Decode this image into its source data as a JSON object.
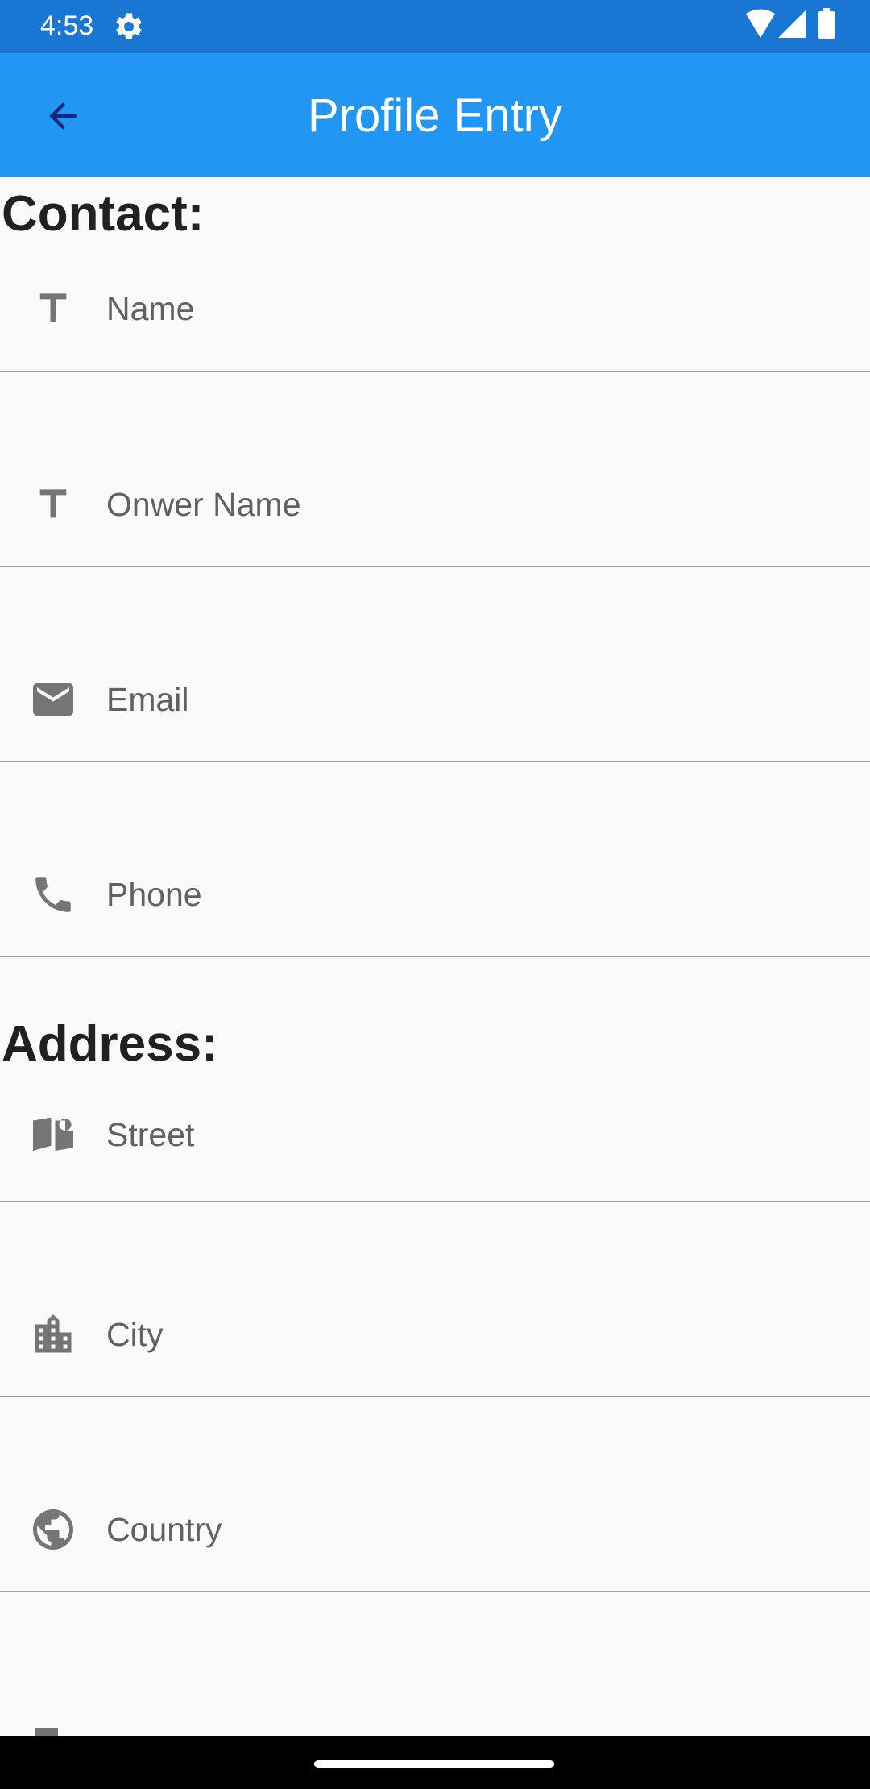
{
  "status_bar": {
    "time": "4:53"
  },
  "app_bar": {
    "title": "Profile Entry"
  },
  "colors": {
    "status_bar": "#1976d2",
    "app_bar": "#2196f3",
    "icon": "#757575"
  },
  "sections": [
    {
      "title": "Contact:",
      "fields": [
        {
          "icon": "text-icon",
          "placeholder": "Name",
          "value": ""
        },
        {
          "icon": "text-icon",
          "placeholder": "Onwer Name",
          "value": ""
        },
        {
          "icon": "email-icon",
          "placeholder": "Email",
          "value": ""
        },
        {
          "icon": "phone-icon",
          "placeholder": "Phone",
          "value": ""
        }
      ]
    },
    {
      "title": "Address:",
      "fields": [
        {
          "icon": "street-icon",
          "placeholder": "Street",
          "value": ""
        },
        {
          "icon": "city-icon",
          "placeholder": "City",
          "value": ""
        },
        {
          "icon": "globe-icon",
          "placeholder": "Country",
          "value": ""
        }
      ]
    }
  ]
}
